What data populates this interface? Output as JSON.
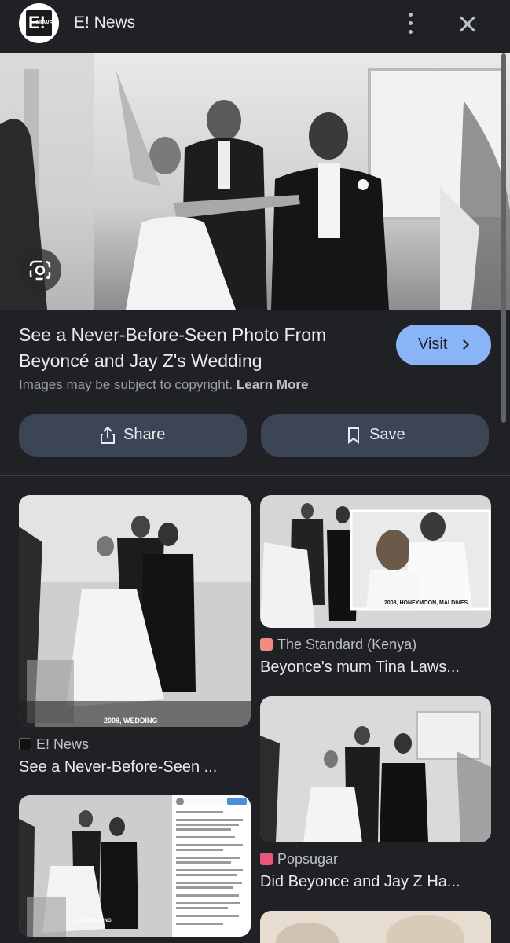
{
  "header": {
    "logo_text": "E!",
    "logo_sub": "NEWS",
    "site_name": "E! News"
  },
  "hero": {
    "title": "See a Never-Before-Seen Photo From Beyoncé and Jay Z's Wedding",
    "visit_label": "Visit",
    "copyright_text": "Images may be subject to copyright.",
    "learn_more": "Learn More",
    "share_label": "Share",
    "save_label": "Save"
  },
  "related": [
    {
      "source": "E! News",
      "caption": "See a Never-Before-Seen ...",
      "overlay": "2008, WEDDING",
      "fav_color": "#111111"
    },
    {
      "source": "The Standard (Kenya)",
      "caption": "Beyonce's mum Tina Laws...",
      "overlay": "2008, HONEYMOON, MALDIVES",
      "fav_color": "#f28b82"
    },
    {
      "source": "Popsugar",
      "caption": "Did Beyonce and Jay Z Ha...",
      "overlay": "",
      "fav_color": "#e8567d"
    },
    {
      "source": "",
      "caption": "",
      "overlay": "2008, WEDDING",
      "fav_color": ""
    }
  ],
  "colors": {
    "accent": "#8ab4f8",
    "background": "#202124",
    "button": "#3c4556"
  }
}
